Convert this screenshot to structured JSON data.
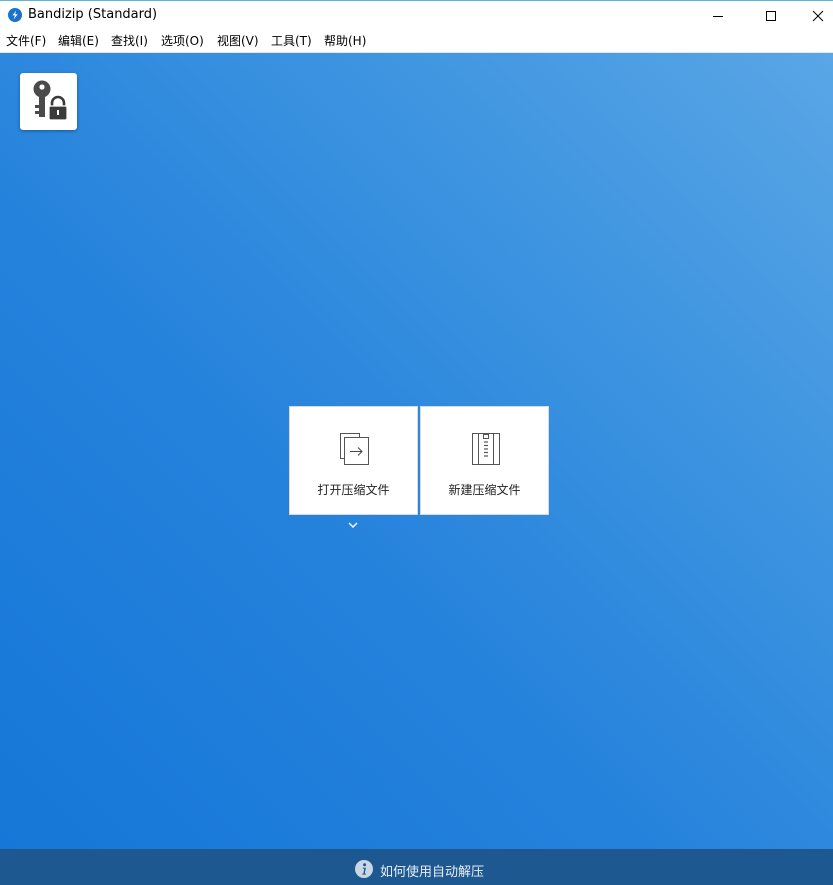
{
  "window": {
    "title": "Bandizip (Standard)",
    "controls": {
      "minimize": "minimize-icon",
      "maximize": "maximize-icon",
      "close": "close-icon"
    }
  },
  "menu": {
    "items": [
      {
        "label": "文件(F)"
      },
      {
        "label": "编辑(E)"
      },
      {
        "label": "查找(I)"
      },
      {
        "label": "选项(O)"
      },
      {
        "label": "视图(V)"
      },
      {
        "label": "工具(T)"
      },
      {
        "label": "帮助(H)"
      }
    ]
  },
  "main": {
    "password_manager_icon": "key-lock-icon",
    "tiles": [
      {
        "label": "打开压缩文件",
        "icon": "open-archive-icon"
      },
      {
        "label": "新建压缩文件",
        "icon": "new-archive-icon"
      }
    ],
    "open_dropdown_icon": "chevron-down-icon"
  },
  "footer": {
    "help_text": "如何使用自动解压",
    "icon": "info-icon"
  },
  "colors": {
    "background_light": "#5aa6e6",
    "background_dark": "#1677d8",
    "footer": "#1e5891",
    "tile": "#ffffff"
  }
}
